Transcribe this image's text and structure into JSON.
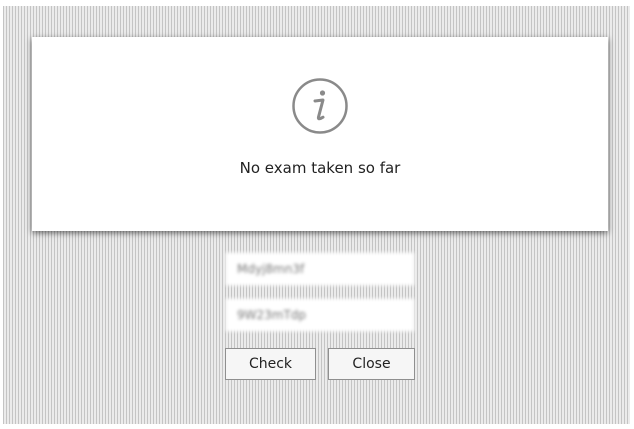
{
  "dialog": {
    "icon": "info-icon",
    "message": "No exam taken so far"
  },
  "login": {
    "username_value": "Mdyj8mn3f",
    "password_value": "9W23mTdp"
  },
  "buttons": {
    "check_label": "Check",
    "close_label": "Close"
  },
  "colors": {
    "icon_gray": "#8a8a8a",
    "dialog_bg": "#ffffff",
    "backdrop_stripe": "#c4c4c4"
  }
}
